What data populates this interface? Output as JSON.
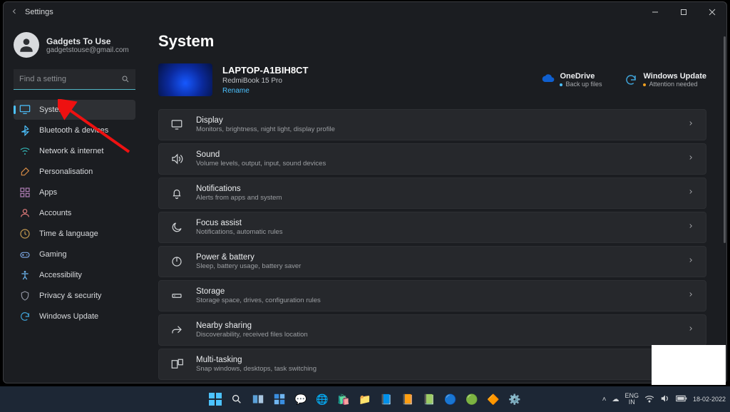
{
  "window": {
    "title": "Settings"
  },
  "user": {
    "name": "Gadgets To Use",
    "email": "gadgetstouse@gmail.com"
  },
  "search": {
    "placeholder": "Find a setting"
  },
  "sidebar": {
    "items": [
      {
        "label": "System",
        "icon": "monitor-icon",
        "color": "#4cc2ff",
        "active": true
      },
      {
        "label": "Bluetooth & devices",
        "icon": "bluetooth-icon",
        "color": "#4cc2ff"
      },
      {
        "label": "Network & internet",
        "icon": "wifi-icon",
        "color": "#33b8b8"
      },
      {
        "label": "Personalisation",
        "icon": "brush-icon",
        "color": "#d48a45"
      },
      {
        "label": "Apps",
        "icon": "grid-icon",
        "color": "#b07eb6"
      },
      {
        "label": "Accounts",
        "icon": "person-icon",
        "color": "#e07a7a"
      },
      {
        "label": "Time & language",
        "icon": "clock-globe-icon",
        "color": "#c49a50"
      },
      {
        "label": "Gaming",
        "icon": "gaming-icon",
        "color": "#7aa4e0"
      },
      {
        "label": "Accessibility",
        "icon": "accessibility-icon",
        "color": "#6cb6ef"
      },
      {
        "label": "Privacy & security",
        "icon": "shield-icon",
        "color": "#8f93a0"
      },
      {
        "label": "Windows Update",
        "icon": "update-icon",
        "color": "#3fa3d8"
      }
    ]
  },
  "page": {
    "title": "System"
  },
  "device": {
    "name": "LAPTOP-A1BIH8CT",
    "model": "RedmiBook 15 Pro",
    "rename": "Rename"
  },
  "header_tiles": {
    "onedrive": {
      "title": "OneDrive",
      "sub": "Back up files"
    },
    "update": {
      "title": "Windows Update",
      "sub": "Attention needed"
    }
  },
  "rows": [
    {
      "icon": "display-icon",
      "title": "Display",
      "desc": "Monitors, brightness, night light, display profile"
    },
    {
      "icon": "sound-icon",
      "title": "Sound",
      "desc": "Volume levels, output, input, sound devices"
    },
    {
      "icon": "bell-icon",
      "title": "Notifications",
      "desc": "Alerts from apps and system"
    },
    {
      "icon": "moon-icon",
      "title": "Focus assist",
      "desc": "Notifications, automatic rules"
    },
    {
      "icon": "power-icon",
      "title": "Power & battery",
      "desc": "Sleep, battery usage, battery saver"
    },
    {
      "icon": "storage-icon",
      "title": "Storage",
      "desc": "Storage space, drives, configuration rules"
    },
    {
      "icon": "share-icon",
      "title": "Nearby sharing",
      "desc": "Discoverability, received files location"
    },
    {
      "icon": "multitask-icon",
      "title": "Multi-tasking",
      "desc": "Snap windows, desktops, task switching"
    }
  ],
  "tray": {
    "lang_top": "ENG",
    "lang_bot": "IN",
    "date": "18-02-2022"
  },
  "colors": {
    "accent": "#4cc2ff"
  }
}
